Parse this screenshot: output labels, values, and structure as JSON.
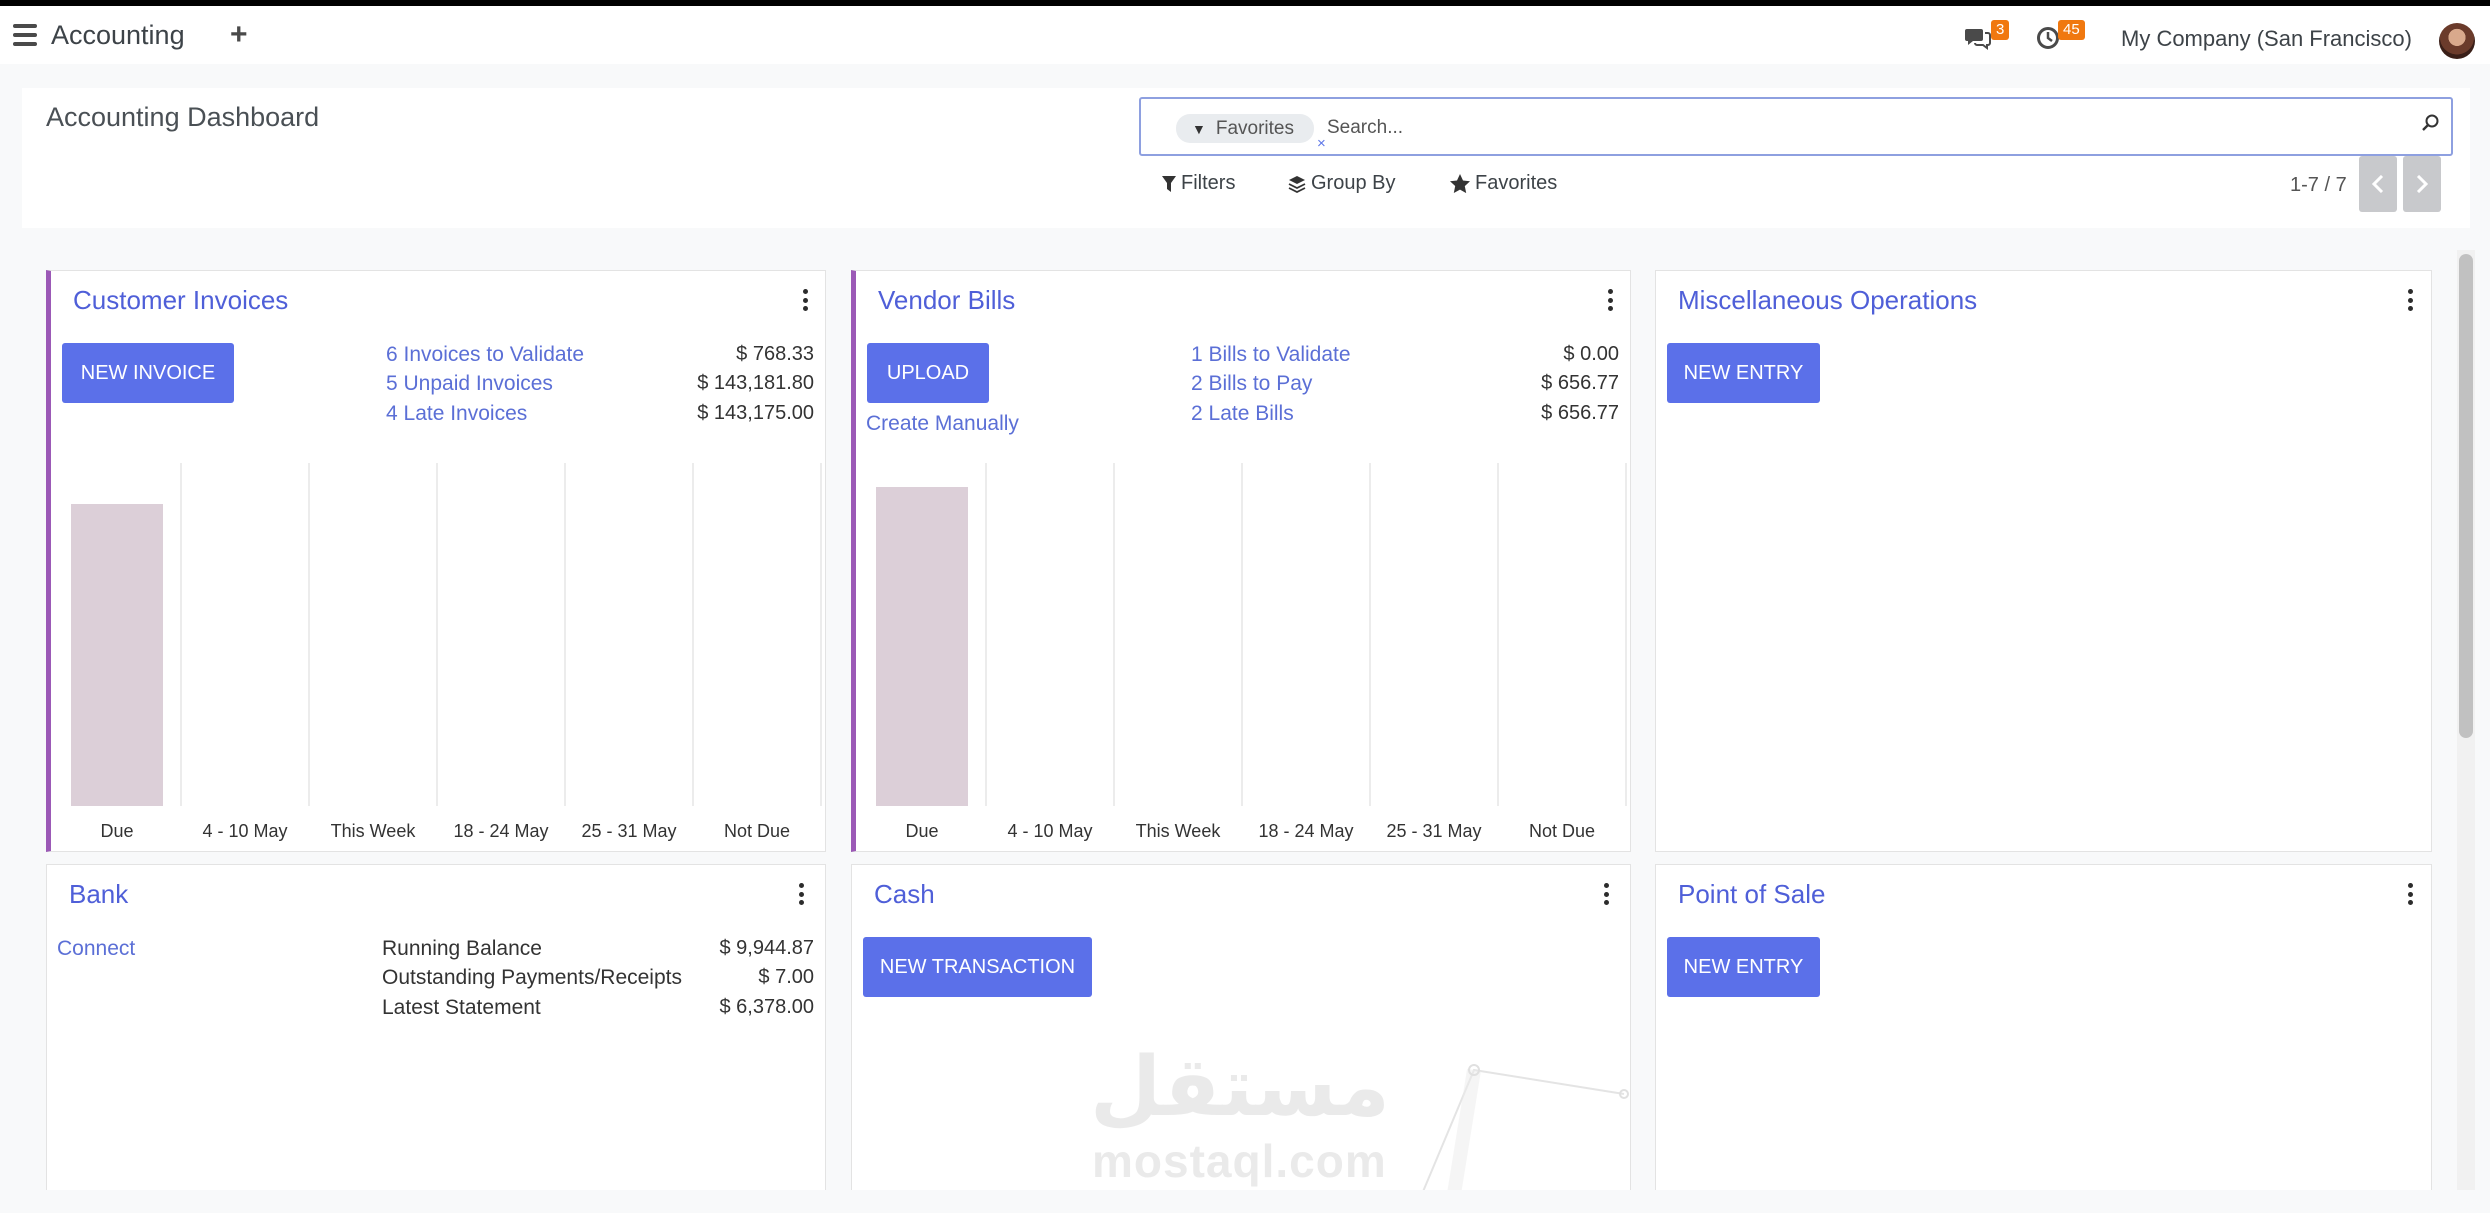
{
  "app": {
    "title": "Accounting",
    "company": "My Company (San Francisco)",
    "messages_count": "3",
    "activities_count": "45"
  },
  "control_panel": {
    "page_title": "Accounting Dashboard",
    "search": {
      "facet_label": "Favorites",
      "placeholder": "Search...",
      "value": ""
    },
    "filters_label": "Filters",
    "group_by_label": "Group By",
    "favorites_label": "Favorites",
    "pager": "1-7 / 7"
  },
  "cards": {
    "customer_invoices": {
      "title": "Customer Invoices",
      "button": "NEW INVOICE",
      "links": [
        {
          "label": "6 Invoices to Validate",
          "amount": "$ 768.33"
        },
        {
          "label": "5 Unpaid Invoices",
          "amount": "$ 143,181.80"
        },
        {
          "label": "4 Late Invoices",
          "amount": "$ 143,175.00"
        }
      ]
    },
    "vendor_bills": {
      "title": "Vendor Bills",
      "button": "UPLOAD",
      "secondary_link": "Create Manually",
      "links": [
        {
          "label": "1 Bills to Validate",
          "amount": "$ 0.00"
        },
        {
          "label": "2 Bills to Pay",
          "amount": "$ 656.77"
        },
        {
          "label": "2 Late Bills",
          "amount": "$ 656.77"
        }
      ]
    },
    "misc_operations": {
      "title": "Miscellaneous Operations",
      "button": "NEW ENTRY"
    },
    "bank": {
      "title": "Bank",
      "link": "Connect",
      "stats": [
        {
          "label": "Running Balance",
          "amount": "$ 9,944.87"
        },
        {
          "label": "Outstanding Payments/Receipts",
          "amount": "$ 7.00"
        },
        {
          "label": "Latest Statement",
          "amount": "$ 6,378.00"
        }
      ]
    },
    "cash": {
      "title": "Cash",
      "button": "NEW TRANSACTION"
    },
    "point_of_sale": {
      "title": "Point of Sale",
      "button": "NEW ENTRY"
    }
  },
  "chart_data": [
    {
      "type": "bar",
      "categories": [
        "Due",
        "4 - 10 May",
        "This Week",
        "18 - 24 May",
        "25 - 31 May",
        "Not Due"
      ],
      "values": [
        0.88,
        0,
        0,
        0,
        0,
        0
      ],
      "title": "",
      "xlabel": "",
      "ylabel": "",
      "ylim": [
        0,
        1
      ],
      "grid": true,
      "colors": [
        "#dccfd8"
      ]
    },
    {
      "type": "bar",
      "categories": [
        "Due",
        "4 - 10 May",
        "This Week",
        "18 - 24 May",
        "25 - 31 May",
        "Not Due"
      ],
      "values": [
        0.93,
        0,
        0,
        0,
        0,
        0
      ],
      "title": "",
      "xlabel": "",
      "ylabel": "",
      "ylim": [
        0,
        1
      ],
      "grid": true,
      "colors": [
        "#dccfd8"
      ]
    }
  ],
  "watermark": {
    "arabic": "مستقل",
    "latin": "mostaql.com"
  },
  "colors": {
    "primary": "#5b70e9",
    "link": "#5b6fd6",
    "accent_border": "#9b59b6",
    "badge": "#f0780f",
    "bar": "#dccfd8"
  }
}
